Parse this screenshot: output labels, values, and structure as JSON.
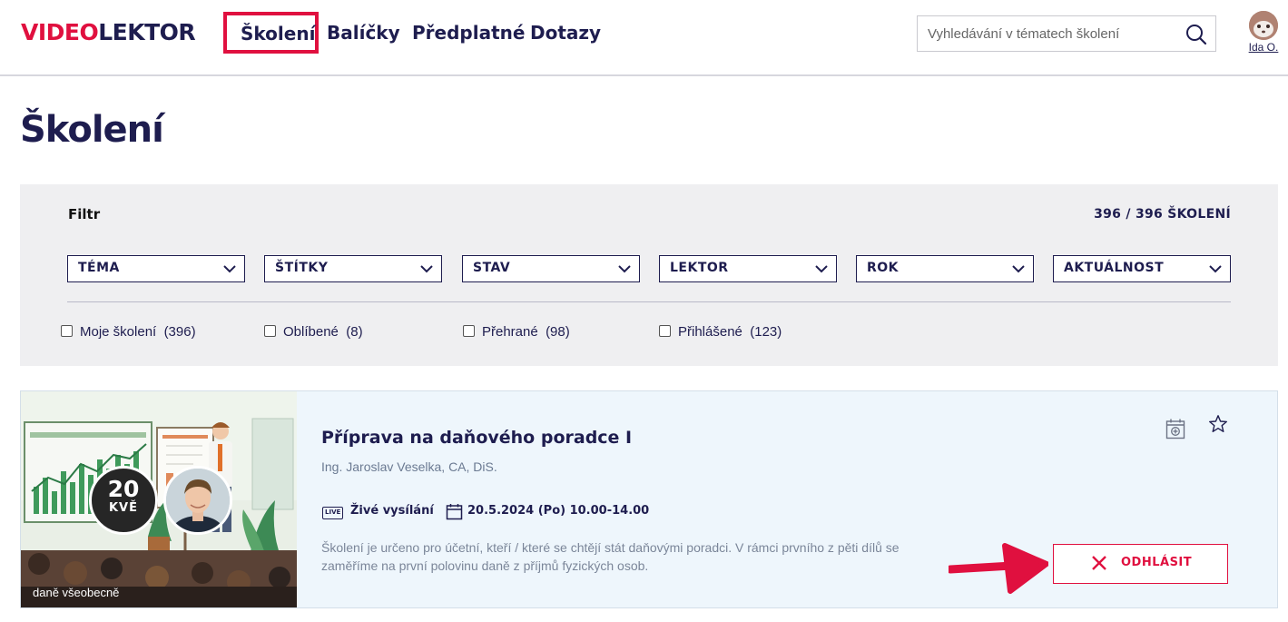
{
  "header": {
    "logo_part1": "VIDEO",
    "logo_part2": "LEKTOR",
    "nav": [
      "Školení",
      "Balíčky",
      "Předplatné",
      "Dotazy"
    ],
    "search_placeholder": "Vyhledávání v tématech školení",
    "user_name": "Ida O."
  },
  "page_title": "Školení",
  "filter": {
    "title": "Filtr",
    "count": "396 / 396 ŠKOLENÍ",
    "selects": [
      "TÉMA",
      "ŠTÍTKY",
      "STAV",
      "LEKTOR",
      "ROK",
      "AKTUÁLNOST"
    ],
    "checkboxes": [
      {
        "label": "Moje školení",
        "count": "(396)"
      },
      {
        "label": "Oblíbené",
        "count": "(8)"
      },
      {
        "label": "Přehrané",
        "count": "(98)"
      },
      {
        "label": "Přihlášené",
        "count": "(123)"
      }
    ]
  },
  "course": {
    "title": "Příprava na daňového poradce I",
    "lector": "Ing. Jaroslav Veselka, CA, DiS.",
    "live_badge": "LIVE",
    "live_label": "Živé vysílání",
    "date": "20.5.2024 (Po) 10.00-14.00",
    "day": "20",
    "month": "KVĚ",
    "description": "Školení je určeno pro účetní, kteří / které se chtějí stát daňovými poradci. V rámci prvního z pěti dílů se zaměříme na první polovinu daně z příjmů fyzických osob.",
    "tag": "daně všeobecně",
    "cta_label": "ODHLÁSIT"
  },
  "colors": {
    "brand_red": "#e0103f",
    "navy": "#1e1d4f",
    "filter_bg": "#efeff1",
    "card_bg": "#eef6fc"
  }
}
